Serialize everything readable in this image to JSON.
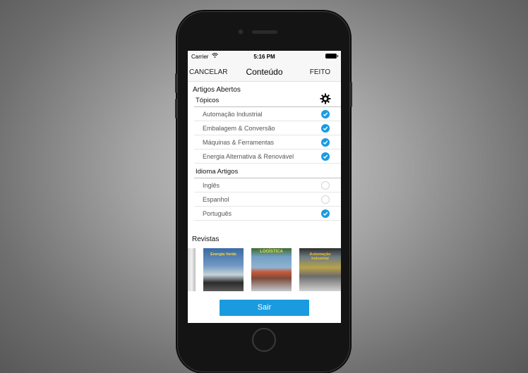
{
  "status_bar": {
    "carrier": "Carrier",
    "time": "5:16 PM"
  },
  "navbar": {
    "cancel_label": "CANCELAR",
    "title": "Conteúdo",
    "done_label": "FEITO"
  },
  "content": {
    "section_title": "Artigos Abertos",
    "topics": {
      "header": "Tópicos",
      "items": [
        {
          "label": "Automação Industrial",
          "checked": true
        },
        {
          "label": "Embalagem & Conversão",
          "checked": true
        },
        {
          "label": "Máquinas & Ferramentas",
          "checked": true
        },
        {
          "label": "Energia Alternativa & Renovável",
          "checked": true
        }
      ]
    },
    "language": {
      "header": "Idioma Artigos",
      "items": [
        {
          "label": "Inglês",
          "checked": false
        },
        {
          "label": "Espanhol",
          "checked": false
        },
        {
          "label": "Português",
          "checked": true
        }
      ]
    }
  },
  "magazines": {
    "header": "Revistas",
    "items": [
      {
        "title": "Energia Verde"
      },
      {
        "title": "LOGÍSTICA"
      },
      {
        "title": "Automação Industrial"
      }
    ]
  },
  "logout_label": "Sair",
  "colors": {
    "accent": "#1a9be0",
    "navbar_bg": "#f7f7f7"
  }
}
